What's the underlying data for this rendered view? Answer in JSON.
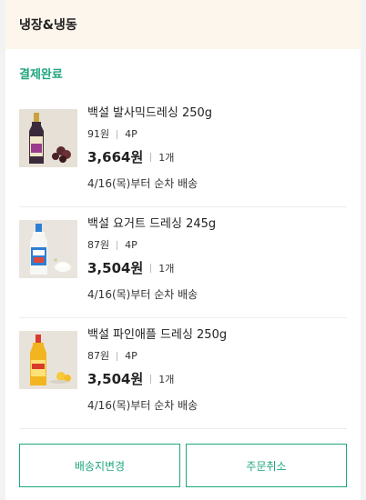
{
  "header": {
    "title": "냉장&냉동"
  },
  "order": {
    "status": "결제완료"
  },
  "items": [
    {
      "name": "백설 발사믹드레싱 250g",
      "unit_price": "91원",
      "points": "4P",
      "price": "3,664원",
      "quantity": "1개",
      "shipping": "4/16(목)부터 순차 배송",
      "thumb_color": "#3b2b3a",
      "label_color": "#9b3c8e"
    },
    {
      "name": "백설 요거트 드레싱 245g",
      "unit_price": "87원",
      "points": "4P",
      "price": "3,504원",
      "quantity": "1개",
      "shipping": "4/16(목)부터 순차 배송",
      "thumb_color": "#f4f4f2",
      "label_color": "#2d7fd3"
    },
    {
      "name": "백설 파인애플 드레싱 250g",
      "unit_price": "87원",
      "points": "4P",
      "price": "3,504원",
      "quantity": "1개",
      "shipping": "4/16(목)부터 순차 배송",
      "thumb_color": "#f2b51f",
      "label_color": "#d93b2b"
    }
  ],
  "actions": {
    "change_address": "배송지변경",
    "cancel_order": "주문취소"
  },
  "colors": {
    "accent": "#1fa67f",
    "header_bg": "#fdf6ec"
  }
}
